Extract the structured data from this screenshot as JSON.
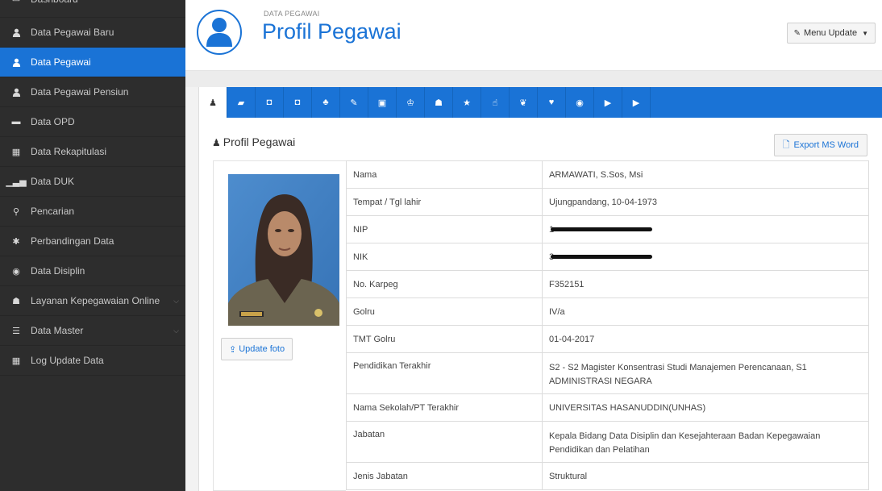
{
  "sidebar": {
    "items": [
      {
        "label": "Dashboard",
        "icon": "dashboard-icon",
        "glyph": "▭",
        "active": false
      },
      {
        "label": "Data Pegawai Baru",
        "icon": "user-icon",
        "glyph": "",
        "active": false
      },
      {
        "label": "Data Pegawai",
        "icon": "user-icon",
        "glyph": "",
        "active": true
      },
      {
        "label": "Data Pegawai Pensiun",
        "icon": "user-icon",
        "glyph": "",
        "active": false
      },
      {
        "label": "Data OPD",
        "icon": "building-icon",
        "glyph": "▬",
        "active": false
      },
      {
        "label": "Data Rekapitulasi",
        "icon": "bar-chart-icon",
        "glyph": "▦",
        "active": false
      },
      {
        "label": "Data DUK",
        "icon": "signal-icon",
        "glyph": "▁▃▅",
        "active": false
      },
      {
        "label": "Pencarian",
        "icon": "search-icon",
        "glyph": "⚲",
        "active": false
      },
      {
        "label": "Perbandingan Data",
        "icon": "asterisk-icon",
        "glyph": "✱",
        "active": false
      },
      {
        "label": "Data Disiplin",
        "icon": "eye-icon",
        "glyph": "◉",
        "active": false
      },
      {
        "label": "Layanan Kepegawaian Online",
        "icon": "users-icon",
        "glyph": "☗",
        "active": false,
        "chevron": true
      },
      {
        "label": "Data Master",
        "icon": "list-icon",
        "glyph": "☰",
        "active": false,
        "chevron": true
      },
      {
        "label": "Log Update Data",
        "icon": "bar-chart-icon",
        "glyph": "▦",
        "active": false
      }
    ]
  },
  "header": {
    "breadcrumb": "DATA PEGAWAI",
    "title": "Profil Pegawai",
    "menu_update_label": "Menu Update"
  },
  "tabs": [
    {
      "icon": "user-icon",
      "glyph": "♟"
    },
    {
      "icon": "book-icon",
      "glyph": "▰"
    },
    {
      "icon": "briefcase-icon",
      "glyph": "◘"
    },
    {
      "icon": "briefcase-icon",
      "glyph": "◘"
    },
    {
      "icon": "sitemap-icon",
      "glyph": "♣"
    },
    {
      "icon": "wrench-icon",
      "glyph": "✎"
    },
    {
      "icon": "money-icon",
      "glyph": "▣"
    },
    {
      "icon": "trophy-icon",
      "glyph": "♔"
    },
    {
      "icon": "users-icon",
      "glyph": "☗"
    },
    {
      "icon": "star-icon",
      "glyph": "★"
    },
    {
      "icon": "thumbs-up-icon",
      "glyph": "☝"
    },
    {
      "icon": "leaf-icon",
      "glyph": "❦"
    },
    {
      "icon": "heart-icon",
      "glyph": "♥"
    },
    {
      "icon": "eye-icon",
      "glyph": "◉"
    },
    {
      "icon": "folder-icon",
      "glyph": "▶"
    },
    {
      "icon": "folder-icon",
      "glyph": "▶"
    }
  ],
  "section": {
    "title": "Profil Pegawai",
    "export_label": "Export MS Word",
    "update_foto_label": "Update foto"
  },
  "profile": {
    "rows": [
      {
        "label": "Nama",
        "value": "ARMAWATI, S.Sos, Msi"
      },
      {
        "label": "Tempat / Tgl lahir",
        "value": "Ujungpandang, 10-04-1973"
      },
      {
        "label": "NIP",
        "value": "1",
        "redacted": true
      },
      {
        "label": "NIK",
        "value": "3",
        "redacted": true
      },
      {
        "label": "No. Karpeg",
        "value": "F352151"
      },
      {
        "label": "Golru",
        "value": "IV/a"
      },
      {
        "label": "TMT Golru",
        "value": "01-04-2017"
      },
      {
        "label": "Pendidikan Terakhir",
        "value": "S2 - S2 Magister Konsentrasi Studi Manajemen Perencanaan, S1 ADMINISTRASI NEGARA",
        "tall": true
      },
      {
        "label": "Nama Sekolah/PT Terakhir",
        "value": "UNIVERSITAS HASANUDDIN(UNHAS)"
      },
      {
        "label": "Jabatan",
        "value": "Kepala Bidang Data Disiplin dan Kesejahteraan Badan Kepegawaian Pendidikan dan Pelatihan",
        "tall": true
      },
      {
        "label": "Jenis Jabatan",
        "value": "Struktural"
      }
    ]
  },
  "colors": {
    "accent": "#1a73d6",
    "sidebar_bg": "#2d2d2d"
  }
}
